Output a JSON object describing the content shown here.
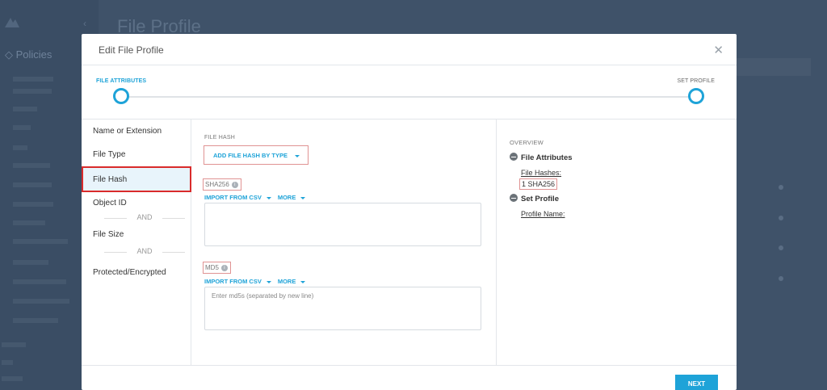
{
  "background": {
    "sidebar_section": "Policies",
    "breadcrumb": "",
    "page_title": "File Profile"
  },
  "modal": {
    "title": "Edit File Profile",
    "close_icon": "close-icon",
    "steps": [
      "FILE ATTRIBUTES",
      "SET PROFILE"
    ],
    "nav": {
      "items": [
        "Name or Extension",
        "File Type",
        "File Hash",
        "Object ID",
        "File Size",
        "Protected/Encrypted"
      ],
      "separator": "AND",
      "active_index": 2
    },
    "form": {
      "section_label": "FILE HASH",
      "add_button": "ADD FILE HASH BY TYPE",
      "sha256": {
        "label": "SHA256",
        "import_link": "IMPORT FROM CSV",
        "more_link": "MORE",
        "value": "",
        "placeholder": ""
      },
      "md5": {
        "label": "MD5",
        "import_link": "IMPORT FROM CSV",
        "more_link": "MORE",
        "value": "",
        "placeholder": "Enter md5s (separated by new line)"
      }
    },
    "overview": {
      "title": "OVERVIEW",
      "file_attributes": "File Attributes",
      "file_hashes_label": "File Hashes:",
      "file_hashes_value": "1 SHA256",
      "set_profile": "Set Profile",
      "profile_name_label": "Profile Name:"
    },
    "next_button": "NEXT"
  },
  "colors": {
    "accent": "#1ea3d8",
    "highlight_border": "#d92b2b",
    "overlay": "#3d5068"
  }
}
